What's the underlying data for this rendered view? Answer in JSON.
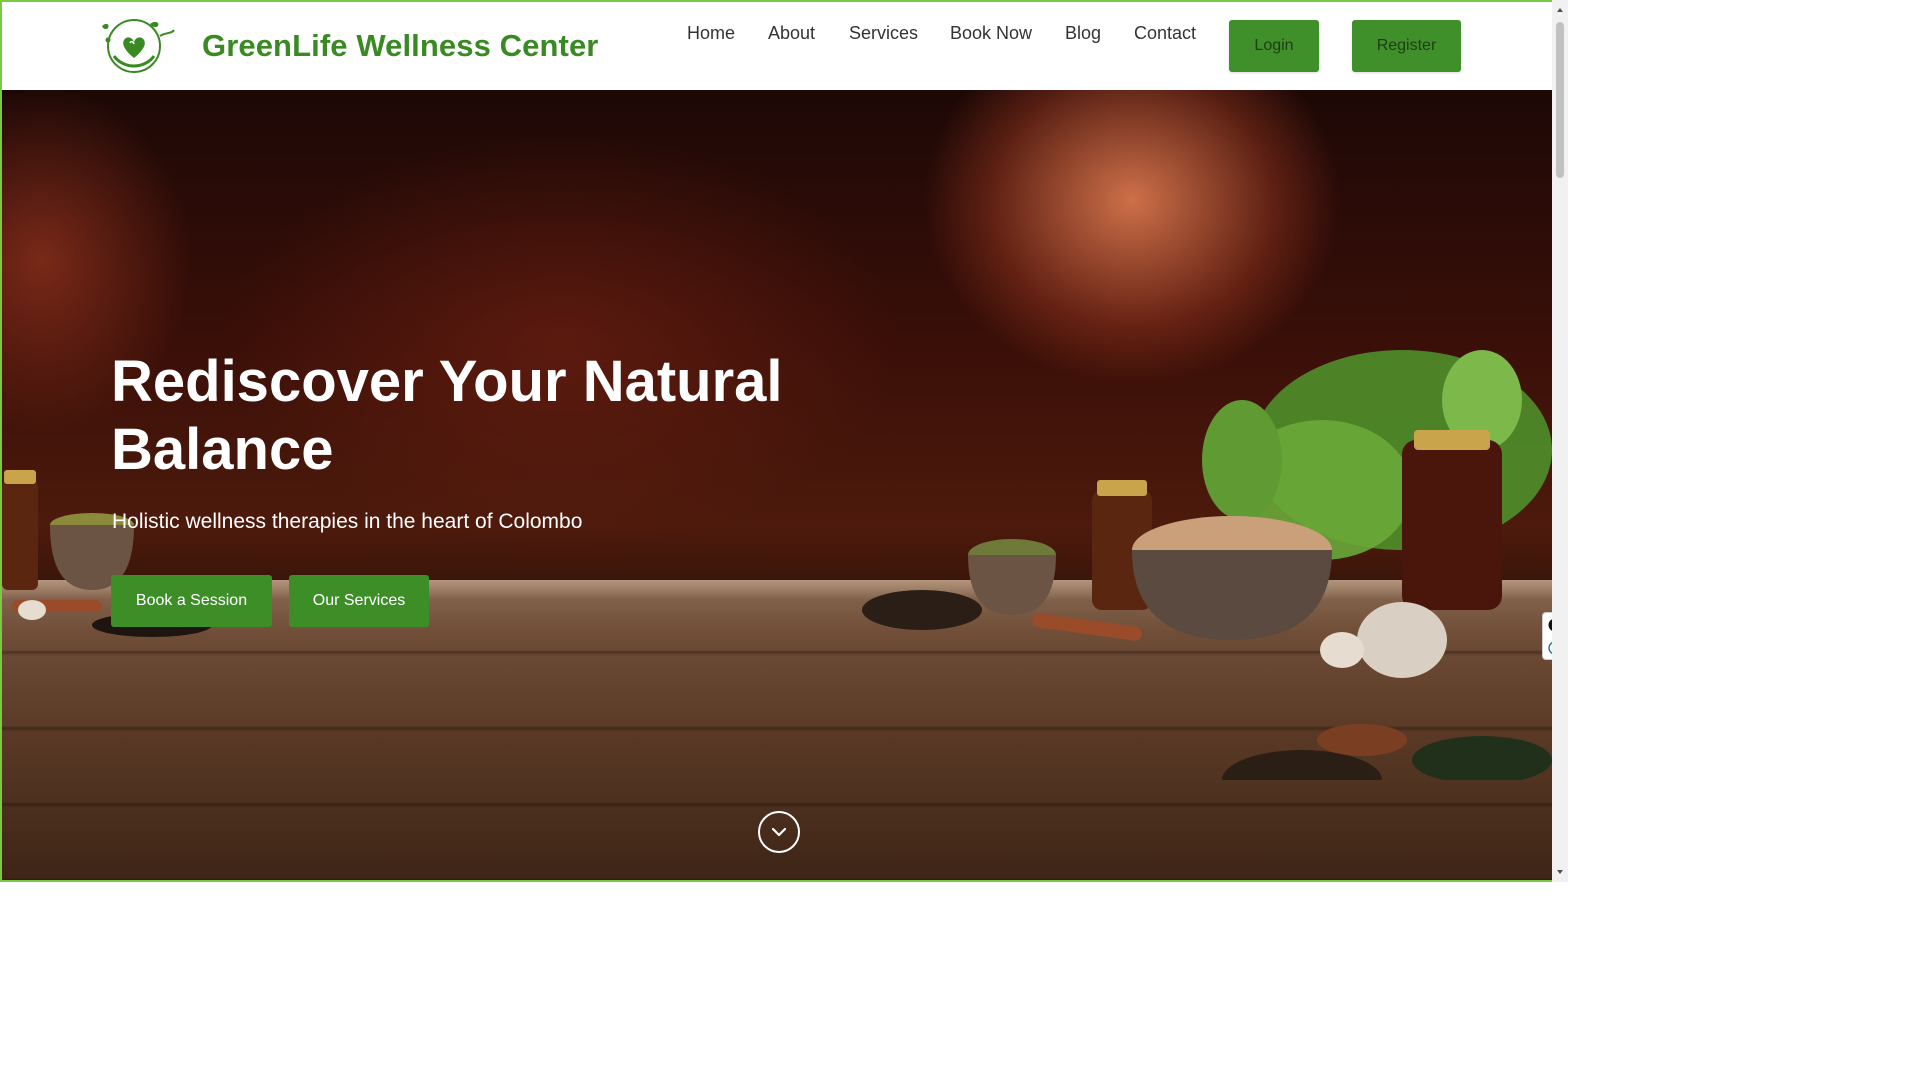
{
  "brand": {
    "name": "GreenLife Wellness Center",
    "color": "#3a8a24"
  },
  "nav": {
    "links": [
      "Home",
      "About",
      "Services",
      "Book Now",
      "Blog",
      "Contact"
    ],
    "login_label": "Login",
    "register_label": "Register"
  },
  "hero": {
    "title": "Rediscover Your Natural Balance",
    "subtitle": "Holistic wellness therapies in the heart of Colombo",
    "primary_button": "Book a Session",
    "secondary_button": "Our Services"
  },
  "colors": {
    "accent": "#3f8f2a",
    "frame_border": "#7ac943"
  },
  "icons": {
    "logo": "leaf-heart-logo",
    "scroll": "chevron-down-icon",
    "widget_close": "close-icon",
    "widget_secondary": "circle-e-icon"
  }
}
